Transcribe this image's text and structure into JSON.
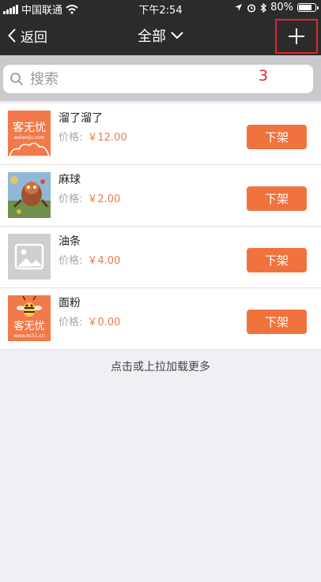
{
  "status_bar": {
    "carrier": "中国联通",
    "time": "下午2:54",
    "battery": "80%",
    "battery_level": 0.8
  },
  "nav": {
    "back_label": "返回",
    "title": "全部",
    "add_icon": "plus-icon"
  },
  "annotation": "3",
  "search": {
    "placeholder": "搜索"
  },
  "products": [
    {
      "name": "溜了溜了",
      "price_label": "价格:",
      "price": "￥12.00",
      "action": "下架",
      "thumb": "logo-orange-cloud",
      "logo_text": "客无忧",
      "logo_sub": "weiwoju.com"
    },
    {
      "name": "麻球",
      "price_label": "价格:",
      "price": "￥2.00",
      "action": "下架",
      "thumb": "photo-illustration"
    },
    {
      "name": "油条",
      "price_label": "价格:",
      "price": "￥4.00",
      "action": "下架",
      "thumb": "image-placeholder-icon"
    },
    {
      "name": "面粉",
      "price_label": "价格:",
      "price": "￥0.00",
      "action": "下架",
      "thumb": "logo-bee",
      "logo_text": "客无忧",
      "logo_sub": "www.kc51.cn"
    }
  ],
  "load_more": "点击或上拉加载更多",
  "colors": {
    "nav_bg": "#2b2b2b",
    "accent": "#f0733e",
    "price": "#ee7a4a",
    "annotation": "#e0252b"
  }
}
